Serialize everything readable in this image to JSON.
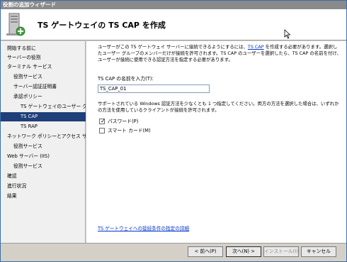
{
  "window": {
    "title": "役割の追加ウィザード"
  },
  "header": {
    "title": "TS ゲートウェイの TS CAP を作成"
  },
  "nav": {
    "items": [
      {
        "label": "開始する前に",
        "level": 0,
        "selected": false
      },
      {
        "label": "サーバーの役割",
        "level": 0,
        "selected": false
      },
      {
        "label": "ターミナル サービス",
        "level": 0,
        "selected": false
      },
      {
        "label": "役割サービス",
        "level": 1,
        "selected": false
      },
      {
        "label": "サーバー認証証明書",
        "level": 1,
        "selected": false
      },
      {
        "label": "承認ポリシー",
        "level": 1,
        "selected": false
      },
      {
        "label": "TS ゲートウェイのユーザー グ...",
        "level": 2,
        "selected": false
      },
      {
        "label": "TS CAP",
        "level": 2,
        "selected": true
      },
      {
        "label": "TS RAP",
        "level": 2,
        "selected": false
      },
      {
        "label": "ネットワーク ポリシーとアクセス サービ...",
        "level": 0,
        "selected": false
      },
      {
        "label": "役割サービス",
        "level": 1,
        "selected": false
      },
      {
        "label": "Web サーバー (IIS)",
        "level": 0,
        "selected": false
      },
      {
        "label": "役割サービス",
        "level": 1,
        "selected": false
      },
      {
        "label": "確認",
        "level": 0,
        "selected": false
      },
      {
        "label": "進行状況",
        "level": 0,
        "selected": false
      },
      {
        "label": "結果",
        "level": 0,
        "selected": false
      }
    ]
  },
  "content": {
    "desc_part1": "ユーザーがこの TS ゲートウェイ サーバーに接続できるようにするには、",
    "desc_link": "TS CAP",
    "desc_part2": " を作成する必要があります。選択したユーザー グループのメンバーだけが接続を許可されます。TS CAP のユーザーを選択したら、TS CAP の名前を付け、ユーザーが接続に使用できる認証方法を指定する必要があります。",
    "name_label": "TS CAP の名前を入力(T):",
    "name_value": "TS_CAP_01",
    "support_text": "サポートされている Windows 認証方法を少なくとも 1 つ指定してください。両方の方法を選択した場合は、いずれかの方法を使用しているクライアントが接続を許可されます。",
    "checkboxes": [
      {
        "label": "パスワード(P)",
        "checked": true
      },
      {
        "label": "スマート カード(M)",
        "checked": false
      }
    ],
    "bottom_link": "TS ゲートウェイへの接続条件の指定の詳細"
  },
  "footer": {
    "back": "< 前へ(P)",
    "next": "次へ(N) >",
    "install": "インストール(I)",
    "cancel": "キャンセル"
  },
  "icons": {
    "server": "server-icon",
    "add": "plus-icon",
    "cursor": "mouse-cursor-icon",
    "check": "check-mark-icon"
  },
  "colors": {
    "selected_bg": "#1f3f7a",
    "link": "#0033cc",
    "titlebar": "#8a8a8a"
  }
}
